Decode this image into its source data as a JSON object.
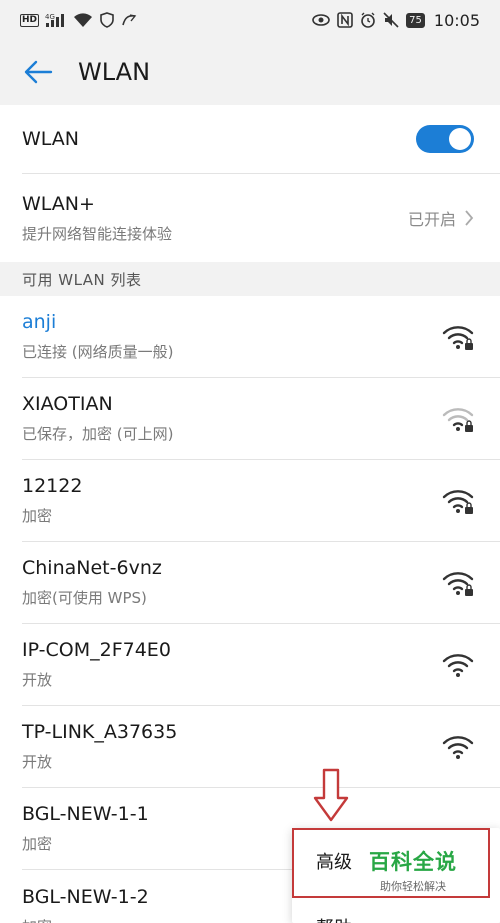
{
  "status_bar": {
    "left_icons": [
      "hd-icon",
      "signal-4g-icon",
      "wifi-icon",
      "shield-icon",
      "link-icon"
    ],
    "hd_label": "HD",
    "battery": "75",
    "time": "10:05"
  },
  "header": {
    "title": "WLAN"
  },
  "wlan_toggle": {
    "label": "WLAN",
    "enabled": true
  },
  "wlan_plus": {
    "label": "WLAN+",
    "subtitle": "提升网络智能连接体验",
    "value": "已开启"
  },
  "section": {
    "title": "可用 WLAN 列表"
  },
  "networks": [
    {
      "name": "anji",
      "status": "已连接 (网络质量一般)",
      "connected": true,
      "secured": true
    },
    {
      "name": "XIAOTIAN",
      "status": "已保存，加密 (可上网)",
      "connected": false,
      "secured": true
    },
    {
      "name": "12122",
      "status": "加密",
      "connected": false,
      "secured": true
    },
    {
      "name": "ChinaNet-6vnz",
      "status": "加密(可使用 WPS)",
      "connected": false,
      "secured": true
    },
    {
      "name": "IP-COM_2F74E0",
      "status": "开放",
      "connected": false,
      "secured": false
    },
    {
      "name": "TP-LINK_A37635",
      "status": "开放",
      "connected": false,
      "secured": false
    },
    {
      "name": "BGL-NEW-1-1",
      "status": "加密",
      "connected": false,
      "secured": true
    },
    {
      "name": "BGL-NEW-1-2",
      "status": "加密",
      "connected": false,
      "secured": true
    }
  ],
  "menu": {
    "items": [
      "高级",
      "帮助"
    ]
  },
  "watermark": {
    "title": "百科全说",
    "subtitle": "助你轻松解决"
  },
  "colors": {
    "accent": "#1c7ed6",
    "highlight": "#c43a3a",
    "watermark": "#28a745"
  }
}
